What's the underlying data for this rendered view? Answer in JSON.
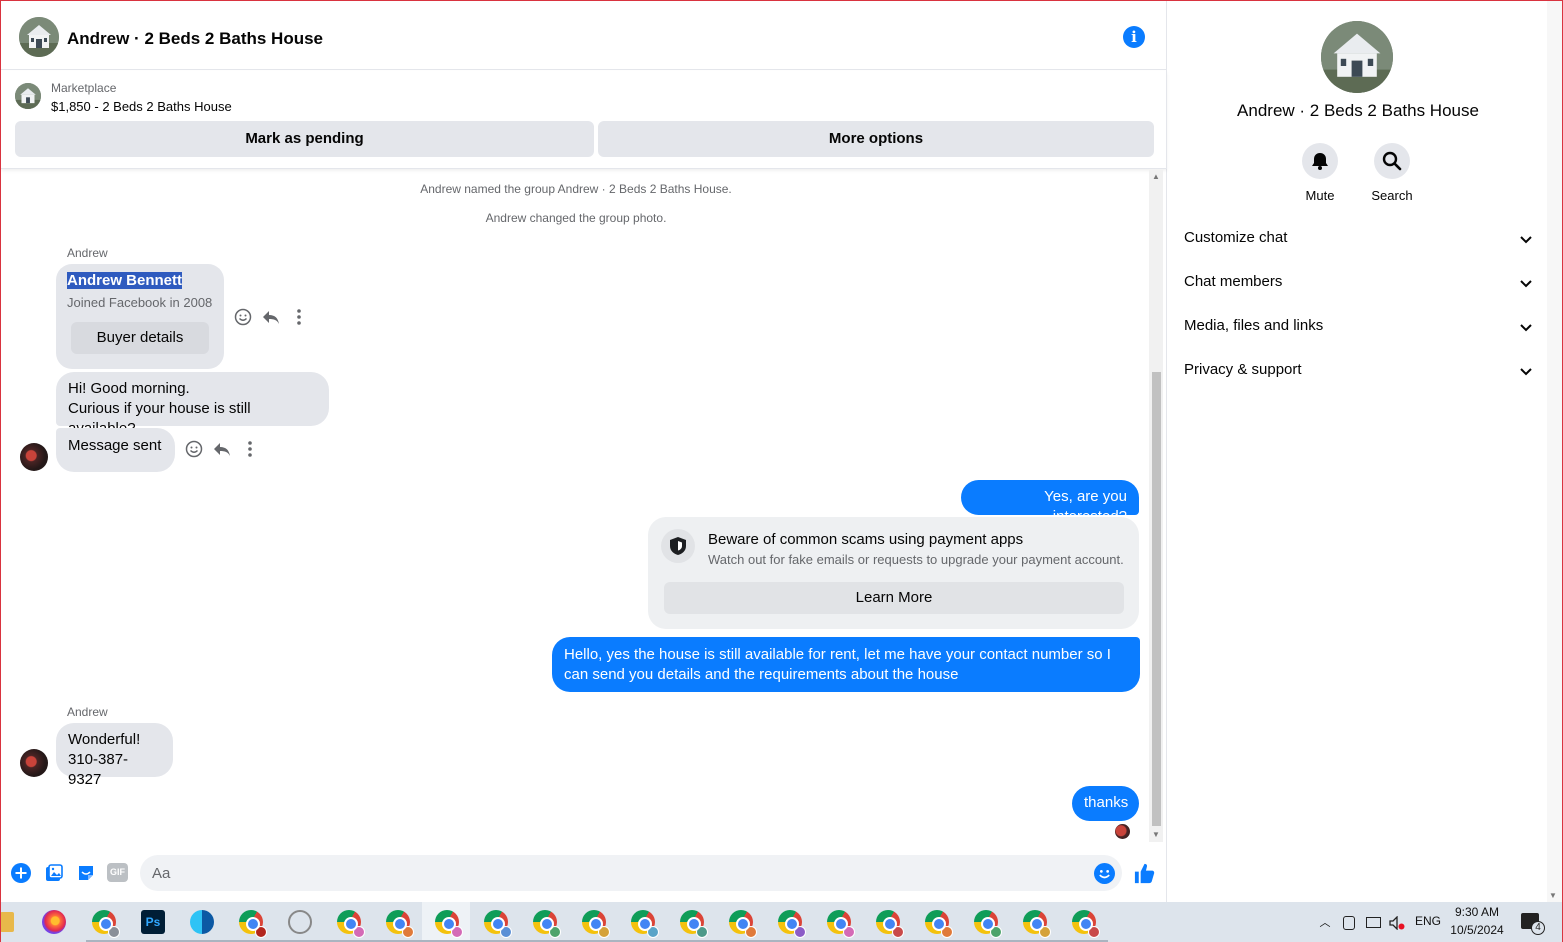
{
  "header": {
    "title": "Andrew · 2 Beds 2 Baths House",
    "info_icon": "info-icon"
  },
  "marketplace": {
    "label": "Marketplace",
    "listing": "$1,850 - 2 Beds 2 Baths House",
    "mark_pending": "Mark as pending",
    "more_options": "More options"
  },
  "messages": {
    "system1": "Andrew named the group Andrew · 2 Beds 2 Baths House.",
    "system2": "Andrew changed the group photo.",
    "sender1": "Andrew",
    "profile_name": "Andrew Bennett",
    "profile_joined": "Joined Facebook in 2008",
    "buyer_details": "Buyer details",
    "msg1_line1": "Hi! Good morning.",
    "msg1_line2": "Curious if your house is still available?",
    "msg2": "Message sent",
    "out1": "Yes, are you interested?",
    "warn_title": "Beware of common scams using payment apps",
    "warn_body": "Watch out for fake emails or requests to upgrade your payment account.",
    "learn_more": "Learn More",
    "out2": "Hello, yes the house is still available for rent, let me have your contact number so I can send you details and the requirements about the house",
    "sender2": "Andrew",
    "msg3_line1": "Wonderful!",
    "msg3_line2": "310-387-9327",
    "out3": "thanks"
  },
  "composer": {
    "placeholder": "Aa"
  },
  "sidebar": {
    "title": "Andrew · 2 Beds 2 Baths House",
    "mute": "Mute",
    "search": "Search",
    "sections": [
      "Customize chat",
      "Chat members",
      "Media, files and links",
      "Privacy & support"
    ]
  },
  "taskbar": {
    "language": "ENG",
    "time": "9:30 AM",
    "date": "10/5/2024",
    "notification_count": "4"
  },
  "colors": {
    "accent": "#0a7cff",
    "bubble_in": "#e4e6eb",
    "highlight": "#2f5bbf"
  }
}
